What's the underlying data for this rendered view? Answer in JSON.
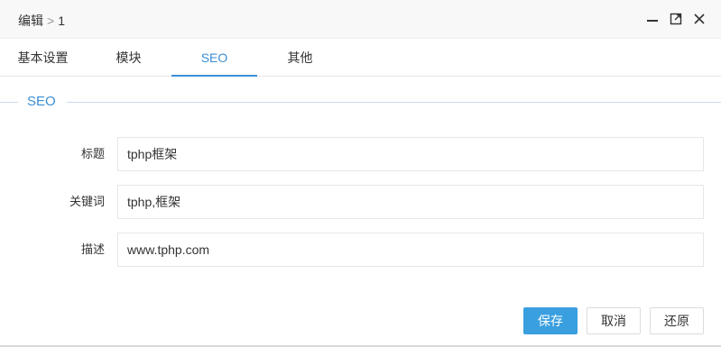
{
  "titlebar": {
    "crumb_parent": "编辑",
    "crumb_separator": ">",
    "crumb_current": "1"
  },
  "tabs": [
    {
      "label": "基本设置",
      "active": false
    },
    {
      "label": "模块",
      "active": false
    },
    {
      "label": "SEO",
      "active": true
    },
    {
      "label": "其他",
      "active": false
    }
  ],
  "section": {
    "legend": "SEO"
  },
  "form": {
    "title_label": "标题",
    "title_value": "tphp框架",
    "keywords_label": "关键词",
    "keywords_value": "tphp,框架",
    "description_label": "描述",
    "description_value": "www.tphp.com"
  },
  "footer": {
    "save_label": "保存",
    "cancel_label": "取消",
    "reset_label": "还原"
  },
  "colors": {
    "accent": "#3b8fd6",
    "primary_button": "#3a9fdf"
  },
  "icons": {
    "minimize": "minimize-icon",
    "maximize": "maximize-icon",
    "close": "close-icon"
  }
}
